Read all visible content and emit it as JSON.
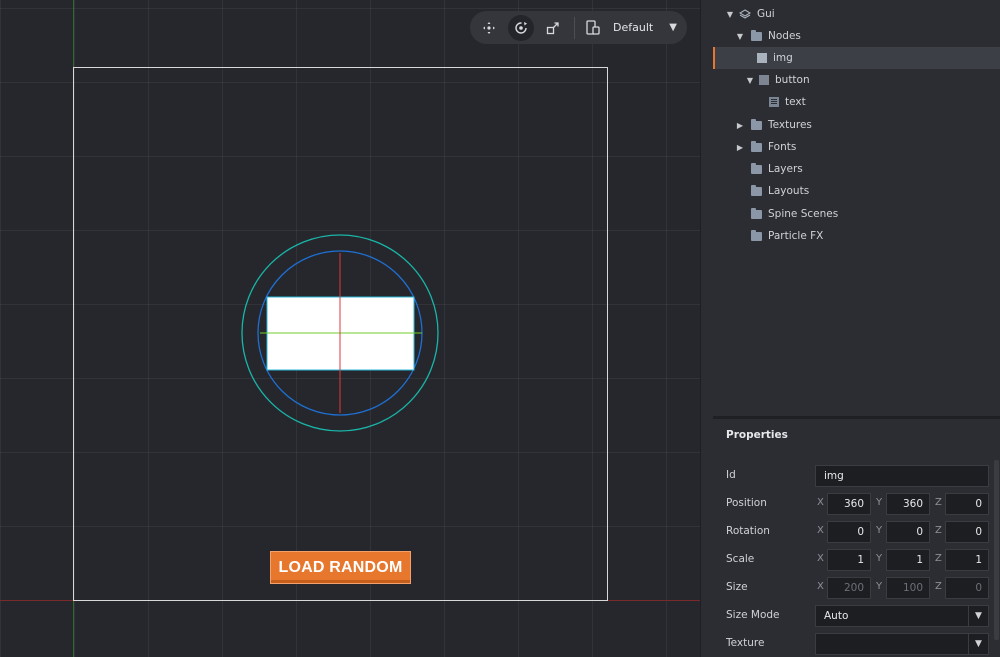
{
  "viewport": {
    "button_label": "LOAD RANDOM",
    "toolbar": {
      "move_tool": "move-icon",
      "rotate_tool": "rotate-icon",
      "scale_tool": "scale-icon",
      "device_icon": "device-icon",
      "layout_label": "Default"
    },
    "colors": {
      "button": "#e8772e",
      "outer_ring": "#19b5a8",
      "inner_ring": "#1e6fd1",
      "selection_box": "#2ab7d8",
      "axis_x": "#e03a3a",
      "axis_y": "#6fcf2a"
    }
  },
  "outline": {
    "items": [
      {
        "label": "Gui"
      },
      {
        "label": "Nodes"
      },
      {
        "label": "img"
      },
      {
        "label": "button"
      },
      {
        "label": "text"
      },
      {
        "label": "Textures"
      },
      {
        "label": "Fonts"
      },
      {
        "label": "Layers"
      },
      {
        "label": "Layouts"
      },
      {
        "label": "Spine Scenes"
      },
      {
        "label": "Particle FX"
      }
    ]
  },
  "properties": {
    "title": "Properties",
    "id": {
      "label": "Id",
      "value": "img"
    },
    "position": {
      "label": "Position",
      "x": "360",
      "y": "360",
      "z": "0"
    },
    "rotation": {
      "label": "Rotation",
      "x": "0",
      "y": "0",
      "z": "0"
    },
    "scale": {
      "label": "Scale",
      "x": "1",
      "y": "1",
      "z": "1"
    },
    "size": {
      "label": "Size",
      "x": "200",
      "y": "100",
      "z": "0"
    },
    "size_mode": {
      "label": "Size Mode",
      "value": "Auto"
    },
    "texture": {
      "label": "Texture",
      "value": ""
    },
    "axis_labels": {
      "x": "X",
      "y": "Y",
      "z": "Z"
    }
  }
}
